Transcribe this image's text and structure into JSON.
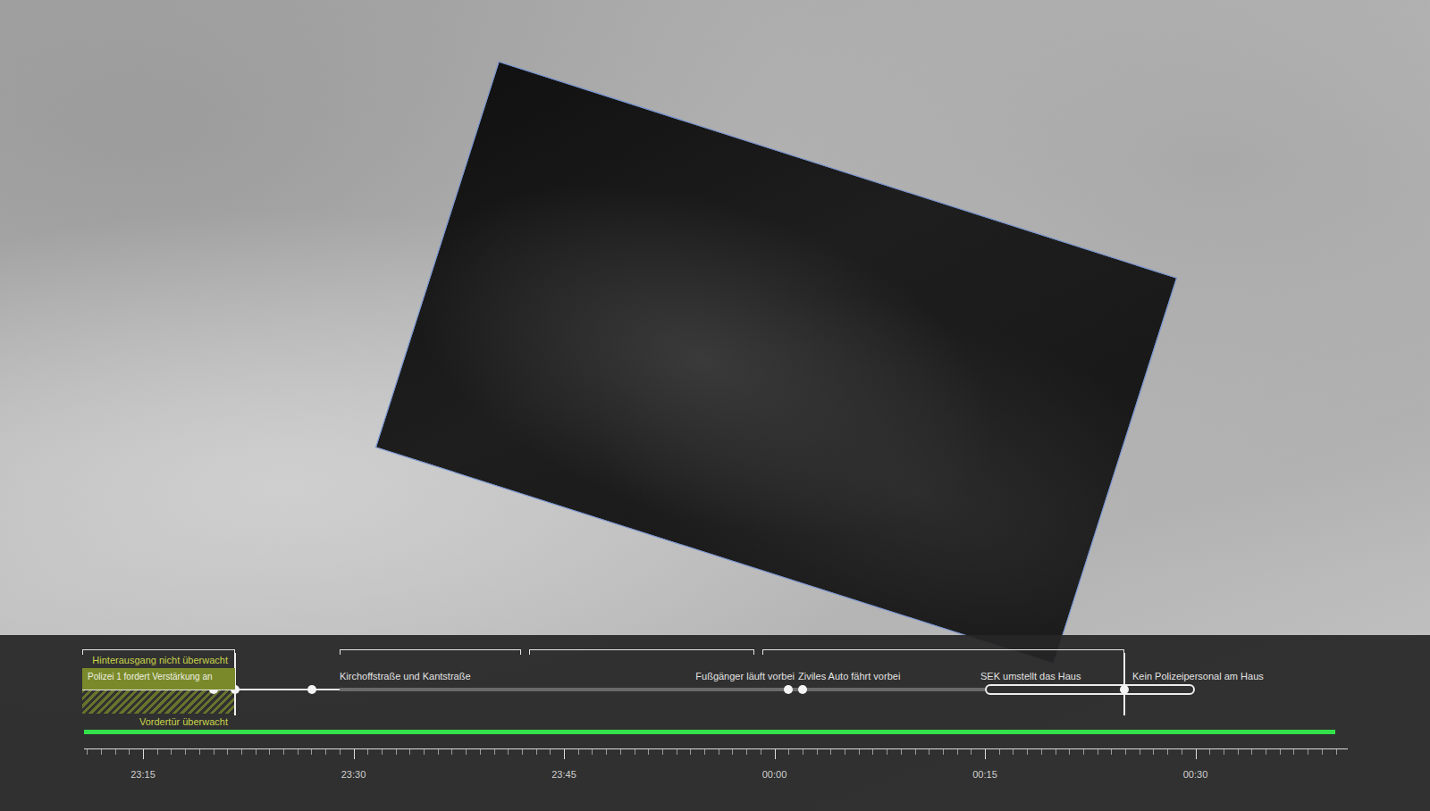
{
  "timeline": {
    "labels": [
      {
        "text": "Hinterausgang nicht überwacht",
        "color": "#c8d34a",
        "kind": "note"
      },
      {
        "text": "Polizei 1 fordert Verstärkung an",
        "color": "#eef0e0",
        "kind": "highlight"
      },
      {
        "text": "Vordertür überwacht",
        "color": "#c8d34a",
        "kind": "note"
      },
      {
        "text": "Kirchoffstraße und Kantstraße",
        "color": "#e2e2e2",
        "kind": "event"
      },
      {
        "text": "Fußgänger läuft vorbei",
        "color": "#e2e2e2",
        "kind": "event"
      },
      {
        "text": "Ziviles Auto fährt vorbei",
        "color": "#e2e2e2",
        "kind": "event"
      },
      {
        "text": "SEK umstellt das Haus",
        "color": "#e2e2e2",
        "kind": "event"
      },
      {
        "text": "Kein Polizeipersonal am Haus",
        "color": "#e2e2e2",
        "kind": "event"
      }
    ],
    "progress": {
      "level": 0.99
    },
    "ticks": [
      "23:15",
      "23:30",
      "23:45",
      "00:00",
      "00:15",
      "00:30"
    ]
  }
}
